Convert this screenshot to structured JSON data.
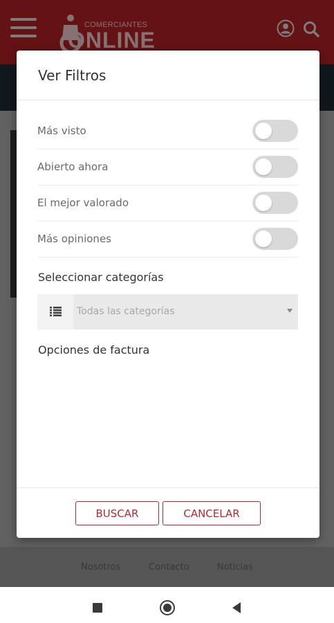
{
  "header": {
    "logo_small": "COMERCIANTES",
    "logo_big": "ONLINE"
  },
  "modal": {
    "title": "Ver Filtros",
    "filters": [
      {
        "label": "Más visto",
        "on": false
      },
      {
        "label": "Abierto ahora",
        "on": false
      },
      {
        "label": "El mejor valorado",
        "on": false
      },
      {
        "label": "Más opiniones",
        "on": false
      }
    ],
    "category_section_label": "Seleccionar categorías",
    "category_select_value": "Todas las categorías",
    "invoice_section_label": "Opciones de factura",
    "search_button": "BUSCAR",
    "cancel_button": "CANCELAR"
  },
  "footer": {
    "links": [
      "Nosotros",
      "Contacto",
      "Noticias"
    ]
  },
  "colors": {
    "brand_red": "#a21d20",
    "button_red": "#b22a31",
    "dark_bar": "#1b2630"
  }
}
